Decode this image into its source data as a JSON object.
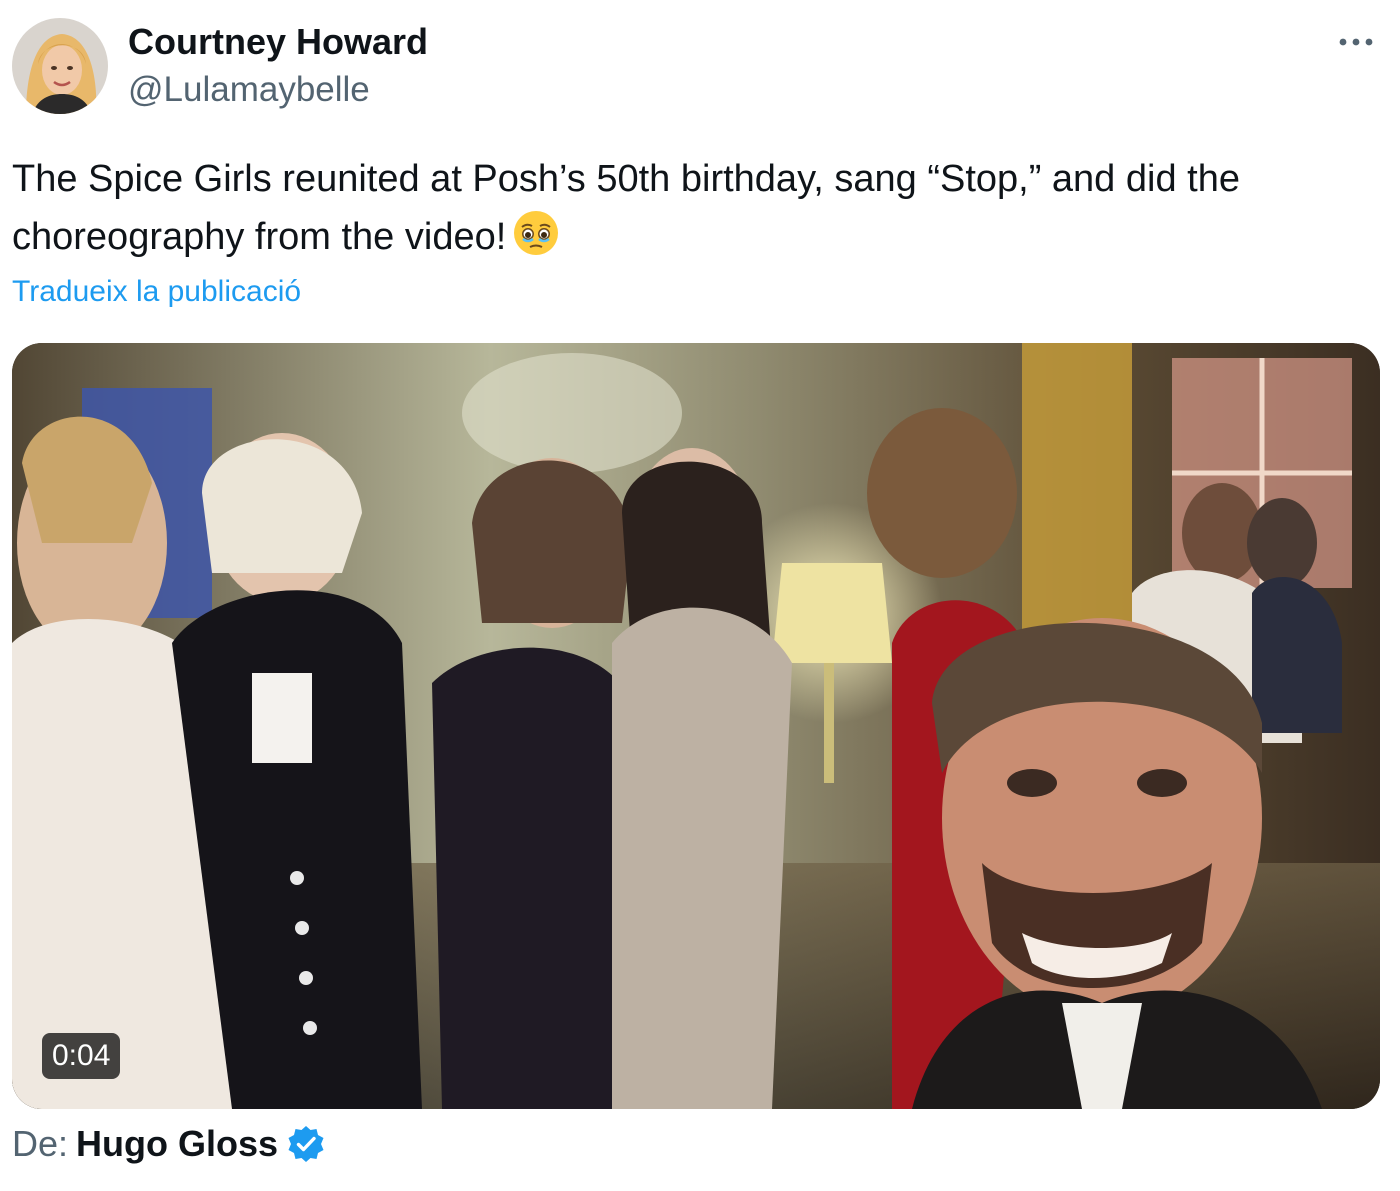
{
  "author": {
    "name": "Courtney Howard",
    "handle": "@Lulamaybelle",
    "avatar_icon": "profile-photo"
  },
  "more_icon": "ellipsis-icon",
  "tweet": {
    "text": "The Spice Girls reunited at Posh’s 50th birthday, sang “Stop,” and did the choreography from the video!",
    "emoji": "face-holding-back-tears",
    "translate_label": "Tradueix la publicació"
  },
  "media": {
    "type": "video",
    "duration": "0:04"
  },
  "source": {
    "prefix": "De:",
    "name": "Hugo Gloss",
    "verified": true
  },
  "colors": {
    "link": "#1d9bf0",
    "secondary_text": "#536471",
    "primary_text": "#0f1419",
    "verified_badge": "#1d9bf0"
  }
}
